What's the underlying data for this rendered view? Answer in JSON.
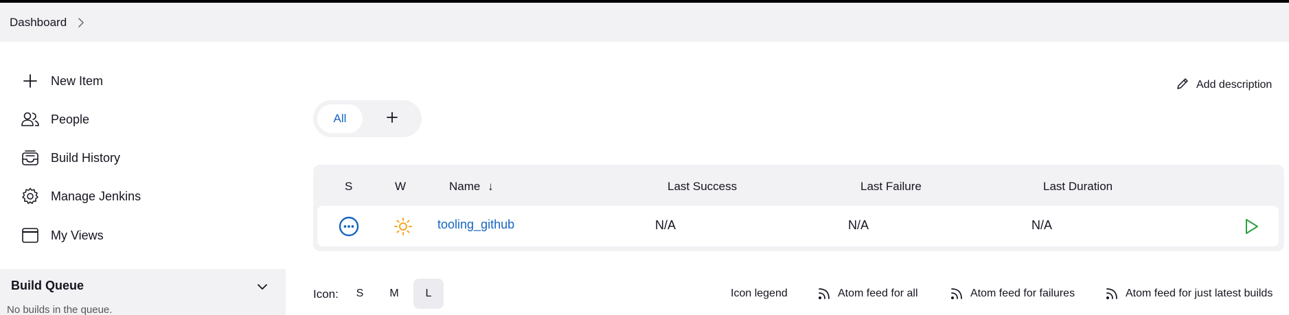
{
  "breadcrumb": {
    "items": [
      "Dashboard"
    ]
  },
  "sidebar": {
    "items": [
      {
        "label": "New Item",
        "icon": "plus-icon"
      },
      {
        "label": "People",
        "icon": "people-icon"
      },
      {
        "label": "Build History",
        "icon": "inbox-icon"
      },
      {
        "label": "Manage Jenkins",
        "icon": "gear-icon"
      },
      {
        "label": "My Views",
        "icon": "window-icon"
      }
    ],
    "build_queue": {
      "title": "Build Queue",
      "empty_text": "No builds in the queue."
    }
  },
  "actions": {
    "add_description": "Add description"
  },
  "view_tabs": {
    "tabs": [
      {
        "label": "All",
        "active": true
      }
    ],
    "add_icon": "plus-icon"
  },
  "jobs_table": {
    "columns": [
      "S",
      "W",
      "Name",
      "Last Success",
      "Last Failure",
      "Last Duration"
    ],
    "sort_indicator": "↓",
    "rows": [
      {
        "status_icon": "pending-status-icon",
        "weather_icon": "sun-icon",
        "name": "tooling_github",
        "last_success": "N/A",
        "last_failure": "N/A",
        "last_duration": "N/A",
        "action_icon": "play-icon"
      }
    ]
  },
  "footer": {
    "icon_label": "Icon:",
    "sizes": [
      {
        "label": "S",
        "active": false
      },
      {
        "label": "M",
        "active": false
      },
      {
        "label": "L",
        "active": true
      }
    ],
    "links": [
      "Icon legend",
      "Atom feed for all",
      "Atom feed for failures",
      "Atom feed for just latest builds"
    ]
  },
  "colors": {
    "accent": "#1565c0",
    "sun": "#f5a623",
    "build_green": "#2ea043",
    "panel_bg": "#f2f2f5"
  }
}
